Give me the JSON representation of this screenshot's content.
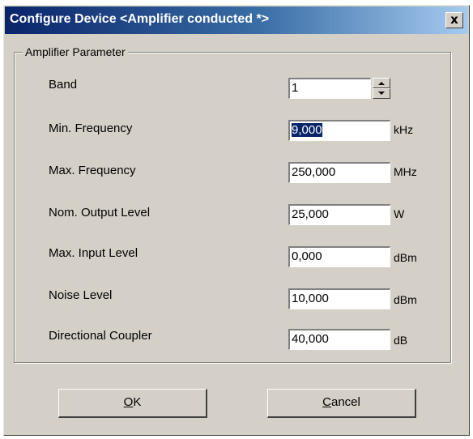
{
  "window": {
    "title": "Configure Device <Amplifier conducted *>",
    "close_label": "x"
  },
  "group": {
    "title": "Amplifier Parameter"
  },
  "rows": [
    {
      "label": "Band",
      "value": "1",
      "unit": ""
    },
    {
      "label": "Min. Frequency",
      "value": "9,000",
      "unit": "kHz"
    },
    {
      "label": "Max. Frequency",
      "value": "250,000",
      "unit": "MHz"
    },
    {
      "label": "Nom. Output Level",
      "value": "25,000",
      "unit": "W"
    },
    {
      "label": "Max. Input Level",
      "value": "0,000",
      "unit": "dBm"
    },
    {
      "label": "Noise Level",
      "value": "10,000",
      "unit": "dBm"
    },
    {
      "label": "Directional Coupler",
      "value": "40,000",
      "unit": "dB"
    }
  ],
  "buttons": {
    "ok": {
      "mnemonic": "O",
      "rest": "K"
    },
    "cancel": {
      "mnemonic": "C",
      "rest": "ancel"
    }
  },
  "colors": {
    "dialog_bg": "#d4d0c8",
    "titlebar_start": "#0a246a",
    "titlebar_end": "#a6caf0",
    "selection": "#0a246a"
  },
  "icons": {
    "spin_up": "triangle-up",
    "spin_down": "triangle-down",
    "close": "x"
  }
}
